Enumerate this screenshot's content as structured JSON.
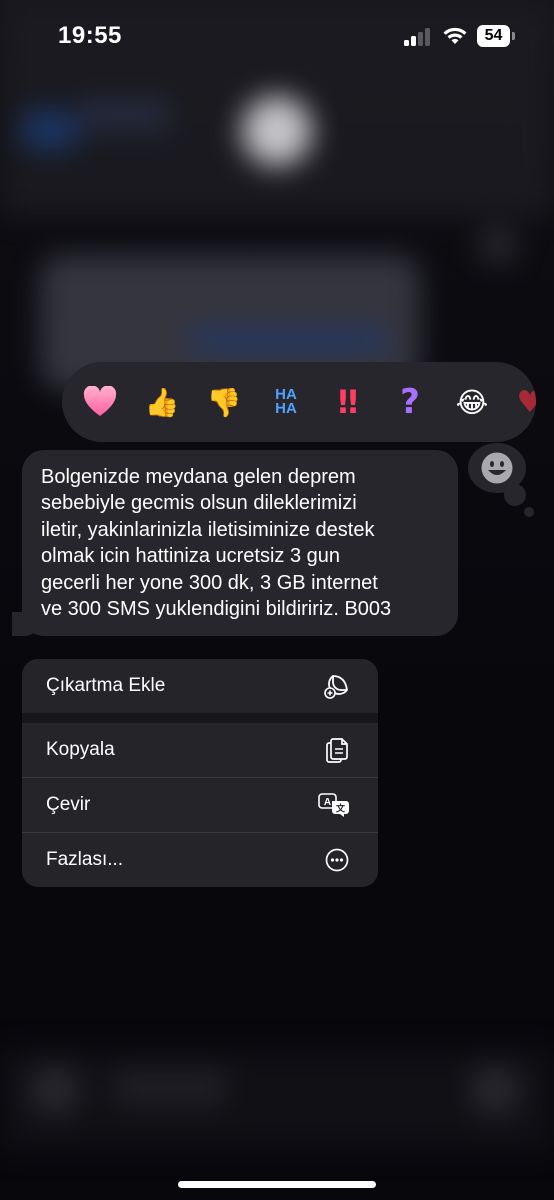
{
  "status_bar": {
    "time": "19:55",
    "battery_level": "54"
  },
  "reactions": [
    {
      "name": "heart",
      "glyph": "♥",
      "color": "#ff7fb0"
    },
    {
      "name": "thumbs-up",
      "glyph": "👍",
      "color": "#f5c24a"
    },
    {
      "name": "thumbs-down",
      "glyph": "👎",
      "color": "#f5a623"
    },
    {
      "name": "haha",
      "glyph_top": "HA",
      "glyph_bottom": "HA",
      "color": "#4da3ff"
    },
    {
      "name": "exclamation",
      "glyph": "‼",
      "color": "#ff4a6a"
    },
    {
      "name": "question",
      "glyph": "?",
      "color": "#b07cff"
    },
    {
      "name": "laugh",
      "glyph": "😂",
      "color": "#f5c24a"
    },
    {
      "name": "heart-partial",
      "glyph": "♥",
      "color": "#b0303a"
    }
  ],
  "message": {
    "text": "Bolgenizde meydana gelen deprem\nsebebiyle gecmis olsun dileklerimizi\niletir,  yakinlarinizla iletisiminize destek\nolmak icin hattiniza ucretsiz 3 gun\ngecerli her yone 300 dk, 3 GB internet\nve 300 SMS yuklendigini bildiririz. B003"
  },
  "menu": {
    "add_sticker": "Çıkartma Ekle",
    "copy": "Kopyala",
    "translate": "Çevir",
    "more": "Fazlası..."
  }
}
